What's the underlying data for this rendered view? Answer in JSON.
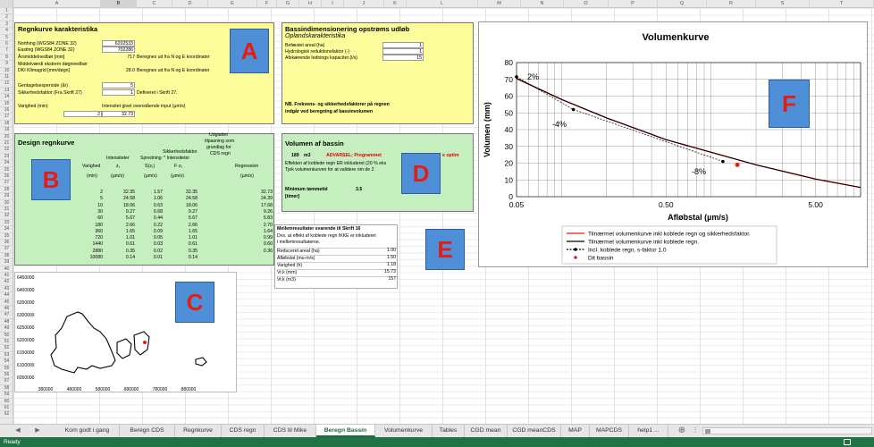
{
  "columns": [
    "A",
    "B",
    "C",
    "D",
    "E",
    "F",
    "G",
    "H",
    "I",
    "J",
    "K",
    "L",
    "M",
    "N",
    "O",
    "P",
    "Q",
    "R",
    "S",
    "T"
  ],
  "rows": [
    "1",
    "2",
    "3",
    "4",
    "5",
    "6",
    "7",
    "8",
    "9",
    "10",
    "11",
    "12",
    "13",
    "14",
    "15",
    "16",
    "17",
    "18",
    "19",
    "20",
    "21",
    "22",
    "23",
    "24",
    "25",
    "26",
    "27",
    "28",
    "29",
    "30",
    "31",
    "32",
    "33",
    "34",
    "35",
    "36",
    "37",
    "38",
    "39",
    "40",
    "41",
    "42",
    "43",
    "44",
    "45",
    "46",
    "47",
    "48",
    "49",
    "50",
    "51",
    "52",
    "53",
    "54",
    "55",
    "56",
    "57",
    "58",
    "59",
    "60",
    "61",
    "62"
  ],
  "regnkurve": {
    "title": "Regnkurve karakteristika",
    "northing_label": "Northing (WGS84 ZONE 32)",
    "northing_value": "6202533",
    "easting_label": "Easting (WGS84 ZONE 32)",
    "easting_value": "702286",
    "aars_label": "Årsmiddelnedbør [mm]",
    "aars_value": "717",
    "aars_note": "Beregnes ud fra N og E koordinater",
    "middel_label1": "Middelværdi ekstrem døgnnedbør",
    "middel_label2": "DKI Klimagrid [mm/døgn]",
    "middel_value": "28.0",
    "middel_note": "Beregnes ud fra N og E koordinater",
    "gent_label": "Gentagelsesperiode (år)",
    "gent_value": "5",
    "sikker_label": "Sikkerhedsfaktor (Fra Skrift 27)",
    "sikker_value": "1",
    "sikker_note": "Defineret i Skrift 27.",
    "varighed_label": "Varighed (min)",
    "intensitet_label": "Intensitet givet ovenstående input (µm/s)",
    "varighed_value": "2",
    "intensitet_value": "32.73"
  },
  "bassin_dim": {
    "title": "Bassindimensionering opstrøms udløb",
    "subtitle": "Oplandskarakteristika",
    "rows": [
      {
        "label": "Befæstet areal (ha)",
        "value": "1"
      },
      {
        "label": "Hydrologisk reduktionsfaktor (-)",
        "value": "1"
      },
      {
        "label": "Afskærende lednings kapacitet (l/s)",
        "value": "15"
      }
    ],
    "note1": "NB. Frekvens- og sikkerhedsfaktorer på regnen",
    "note2": "indgår ved beregning af bassinvolumen"
  },
  "design": {
    "title": "Design regnkurve",
    "headers": {
      "varighed": [
        "Varighed",
        "(min)"
      ],
      "intensitet": [
        "Intensiteter",
        "z₁",
        "(µm/s)"
      ],
      "spredning": [
        "Spredning",
        "S(z₁)",
        "(µm/s)"
      ],
      "sikker": [
        "Sikkerhedsfaktor",
        "* Intensiteter",
        "F·z₁",
        "(µm/s)"
      ],
      "udglattet": [
        "Udglattet",
        "tilpasning som",
        "grundlag for",
        "CDS regn",
        "Regression",
        "(µm/s)"
      ]
    },
    "rows": [
      [
        "2",
        "32.35",
        "1.57",
        "32.35",
        "32.73"
      ],
      [
        "5",
        "24.58",
        "1.06",
        "24.58",
        "24.39"
      ],
      [
        "10",
        "18.06",
        "0.63",
        "18.06",
        "17.68"
      ],
      [
        "30",
        "9.27",
        "0.68",
        "9.27",
        "9.26"
      ],
      [
        "60",
        "5.67",
        "0.44",
        "5.67",
        "5.83"
      ],
      [
        "180",
        "2.66",
        "0.22",
        "2.66",
        "2.70"
      ],
      [
        "360",
        "1.65",
        "0.09",
        "1.65",
        "1.64"
      ],
      [
        "720",
        "1.01",
        "0.05",
        "1.01",
        "0.99"
      ],
      [
        "1440",
        "0.61",
        "0.03",
        "0.61",
        "0.60"
      ],
      [
        "2880",
        "0.35",
        "0.02",
        "0.35",
        "0.36"
      ],
      [
        "10080",
        "0.14",
        "0.01",
        "0.14",
        ""
      ]
    ]
  },
  "volumen": {
    "title": "Volumen af bassin",
    "volume_value": "189",
    "volume_unit": "m3",
    "warning": "ADVARSEL: Programmet",
    "warning_tail": "e optim",
    "line1": "Effekten af koblede regn ER inkluderet (20 % eks",
    "line2": "Tjek volumenkurven for at validere om de 2",
    "min_label1": "Minimum tømmetid",
    "min_label2": "[timer]",
    "min_value": "3.5"
  },
  "mellem": {
    "title": "Mellemresultater svarende til Skrift 16",
    "desc1": "Dvs. at effekt af koblede regn IKKE er inkluderet",
    "desc2": "i mellemresultaterne.",
    "rows": [
      {
        "label": "Reduceret areal (ha)",
        "value": "1.00"
      },
      {
        "label": "Afløbstal (mu-m/s)",
        "value": "1.50"
      },
      {
        "label": "Varighed (h)",
        "value": "1.18"
      },
      {
        "label": "Vr,k (mm)",
        "value": "15.73"
      },
      {
        "label": "Vr,k (m3)",
        "value": "157"
      }
    ]
  },
  "letters": {
    "a": "A",
    "b": "B",
    "c": "C",
    "d": "D",
    "e": "E",
    "f": "F"
  },
  "map": {
    "y_ticks": [
      "6450000",
      "6400000",
      "6350000",
      "6300000",
      "6250000",
      "6200000",
      "6150000",
      "6100000",
      "6050000"
    ],
    "x_ticks": [
      "380000",
      "480000",
      "580000",
      "680000",
      "780000",
      "880000"
    ],
    "marker_color": "#e51c14"
  },
  "chart_data": {
    "type": "line",
    "title": "Volumenkurve",
    "xlabel": "Afløbstal (µm/s)",
    "ylabel": "Volumen (mm)",
    "x_scale": "log",
    "xlim": [
      0.05,
      10
    ],
    "ylim": [
      0,
      80
    ],
    "x_tick_labels": [
      "0.05",
      "0.50",
      "5.00"
    ],
    "y_ticks": [
      0,
      10,
      20,
      30,
      40,
      50,
      60,
      70,
      80
    ],
    "grid": true,
    "series": [
      {
        "name": "Tilnærmet volumenkurve inkl koblede regn og sikkerhedsfaktor.",
        "color": "#e51c14",
        "x": [
          0.05,
          0.1,
          0.2,
          0.5,
          1.0,
          2.0,
          5.0,
          10.0
        ],
        "y": [
          70.5,
          58.0,
          47.0,
          34.0,
          26.5,
          19.0,
          10.5,
          5.5
        ]
      },
      {
        "name": "Tilnærmet volumenkurve inkl koblede regn.",
        "color": "#000000",
        "x": [
          0.05,
          0.1,
          0.2,
          0.5,
          1.0,
          2.0,
          5.0,
          10.0
        ],
        "y": [
          70.5,
          58.0,
          47.0,
          34.0,
          26.5,
          19.0,
          10.5,
          5.5
        ]
      },
      {
        "name": "Incl. koblede regn, s-faktor 1,0",
        "color": "#000000",
        "x": [
          0.05,
          0.12,
          1.2
        ],
        "y": [
          71.5,
          52.0,
          21.0
        ]
      },
      {
        "name": "Dit bassin",
        "color": "#e51c14",
        "x": [
          1.5
        ],
        "y": [
          19.0
        ]
      }
    ],
    "annotations": [
      "2%",
      "-4%",
      "-8%"
    ]
  },
  "tabs": [
    "Kom godt i gang",
    "Beregn CDS",
    "Regnkurve",
    "CDS regn",
    "CDS til Mike",
    "Beregn Bassin",
    "Volumenkurve",
    "Tables",
    "CGD mean",
    "CGD meanCDS",
    "MAP",
    "MAPCDS",
    "help1 ..."
  ],
  "active_tab": "Beregn Bassin",
  "status": "Ready"
}
